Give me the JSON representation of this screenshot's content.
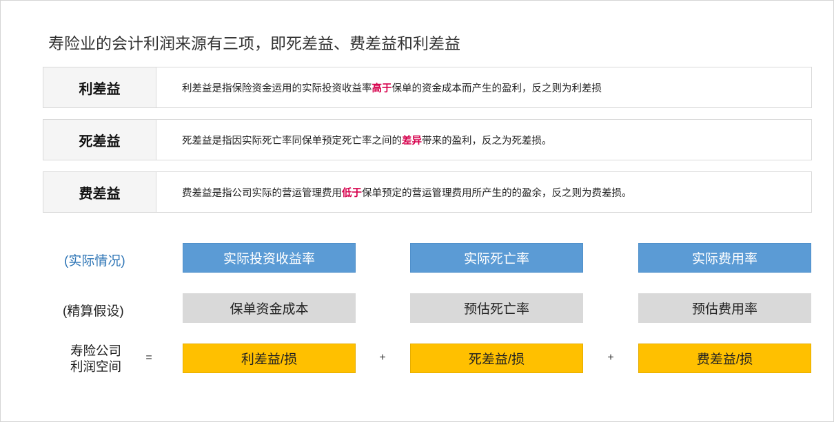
{
  "title": "寿险业的会计利润来源有三项，即死差益、费差益和利差益",
  "definitions": [
    {
      "term": "利差益",
      "before": "利差益是指保险资金运用的实际投资收益率",
      "highlight": "高于",
      "after": "保单的资金成本而产生的盈利，反之则为利差损"
    },
    {
      "term": "死差益",
      "before": "死差益是指因实际死亡率同保单预定死亡率之间的",
      "highlight": "差异",
      "after": "带来的盈利，反之为死差损。"
    },
    {
      "term": "费差益",
      "before": "费差益是指公司实际的营运管理费用",
      "highlight": "低于",
      "after": "保单预定的营运管理费用所产生的的盈余，反之则为费差损。"
    }
  ],
  "rows": {
    "actual": {
      "label": "(实际情况)",
      "items": [
        "实际投资收益率",
        "实际死亡率",
        "实际费用率"
      ]
    },
    "assumption": {
      "label": "(精算假设)",
      "items": [
        "保单资金成本",
        "预估死亡率",
        "预估费用率"
      ]
    },
    "profit": {
      "label_line1": "寿险公司",
      "label_line2": "利润空间",
      "equals": "=",
      "plus": "+",
      "items": [
        "利差益/损",
        "死差益/损",
        "费差益/损"
      ]
    }
  },
  "colors": {
    "highlight": "#d6004c",
    "actual_box": "#5b9bd5",
    "actual_label": "#2e75b6",
    "assumption_box": "#d9d9d9",
    "profit_box": "#ffc000"
  }
}
